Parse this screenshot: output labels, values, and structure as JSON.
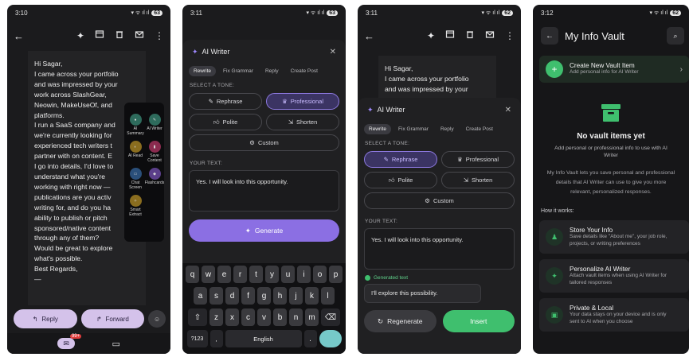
{
  "colors": {
    "accent_purple": "#8b6fe3",
    "pill": "#d4c2ea",
    "green": "#3fbf6e",
    "dark_bg": "#1b1b1d"
  },
  "screen1": {
    "time": "3:10",
    "battery": "63",
    "email_lines": [
      "Hi Sagar,",
      "I came across your portfolio",
      "and was impressed by your",
      "work across SlashGear,",
      "Neowin, MakeUseOf, and",
      "platforms.",
      "I run a SaaS company and",
      "we're currently looking for",
      "experienced tech writers t",
      "partner with on content. E",
      "I go into details, I'd love to",
      "understand what you're",
      "working with right now —",
      "publications are you activ",
      "writing for, and do you ha",
      "ability to publish or pitch",
      "sponsored/native content",
      "through any of them?",
      "Would be great to explore",
      "what's possible.",
      "Best Regards,",
      "—"
    ],
    "reply_label": "Reply",
    "forward_label": "Forward",
    "mail_badge": "99+",
    "popup_items": [
      {
        "label": "AI Summary",
        "icon": "summary-icon",
        "color": "#2e6b5c"
      },
      {
        "label": "AI Writer",
        "icon": "pen-icon",
        "color": "#2e6b5c"
      },
      {
        "label": "AI Read",
        "icon": "speaker-icon",
        "color": "#8a6d1f"
      },
      {
        "label": "Save Content",
        "icon": "bookmark-icon",
        "color": "#8a2b4f"
      },
      {
        "label": "Chat Screen",
        "icon": "chat-icon",
        "color": "#2a4f7a"
      },
      {
        "label": "Flashcards",
        "icon": "flashcard-icon",
        "color": "#5b3f8a"
      },
      {
        "label": "Smart Extract",
        "icon": "bulb-icon",
        "color": "#8a6d1f"
      }
    ]
  },
  "screen2": {
    "time": "3:11",
    "battery": "63",
    "title": "AI Writer",
    "tabs": [
      "Rewrite",
      "Fix Grammar",
      "Reply",
      "Create Post"
    ],
    "select_tone_label": "SELECT A TONE:",
    "tones": [
      "Rephrase",
      "Professional",
      "Polite",
      "Shorten",
      "Custom"
    ],
    "your_text_label": "YOUR TEXT:",
    "your_text": "Yes. I will look into this opportunity.",
    "generate_label": "Generate",
    "keys_row1": [
      "q",
      "w",
      "e",
      "r",
      "t",
      "y",
      "u",
      "i",
      "o",
      "p"
    ],
    "keys_row2": [
      "a",
      "s",
      "d",
      "f",
      "g",
      "h",
      "j",
      "k",
      "l"
    ],
    "keys_row3": [
      "z",
      "x",
      "c",
      "v",
      "b",
      "n",
      "m"
    ],
    "sym_key": "?123",
    "space_key": "English",
    "period_key": "."
  },
  "screen3": {
    "time": "3:11",
    "battery": "62",
    "email_lines": [
      "Hi Sagar,",
      "I came across your portfolio",
      "and was impressed by your"
    ],
    "title": "AI Writer",
    "tabs": [
      "Rewrite",
      "Fix Grammar",
      "Reply",
      "Create Post"
    ],
    "select_tone_label": "SELECT A TONE:",
    "tones": [
      "Rephrase",
      "Professional",
      "Polite",
      "Shorten",
      "Custom"
    ],
    "your_text_label": "YOUR TEXT:",
    "your_text": "Yes. I will look into this opportunity.",
    "generated_label": "Generated text",
    "generated_text": "I'll explore this possibility.",
    "regenerate_label": "Regenerate",
    "insert_label": "Insert"
  },
  "screen4": {
    "time": "3:12",
    "battery": "62",
    "title": "My Info Vault",
    "create_title": "Create New Vault Item",
    "create_sub": "Add personal info for AI Writer",
    "empty_title": "No vault items yet",
    "empty_sub": [
      "Add personal or professional info to use with AI",
      "Writer"
    ],
    "desc": [
      "My Info Vault lets you save personal and professional",
      "details that AI Writer can use to give you more",
      "relevant, personalized responses."
    ],
    "how_label": "How it works:",
    "steps": [
      {
        "title": "Store Your Info",
        "sub": [
          "Save details like \"About me\", your job role,",
          "projects, or writing preferences"
        ]
      },
      {
        "title": "Personalize AI Writer",
        "sub": [
          "Attach vault items when using AI Writer for",
          "tailored responses"
        ]
      },
      {
        "title": "Private & Local",
        "sub": [
          "Your data stays on your device and is only",
          "sent to AI when you choose"
        ]
      }
    ]
  }
}
